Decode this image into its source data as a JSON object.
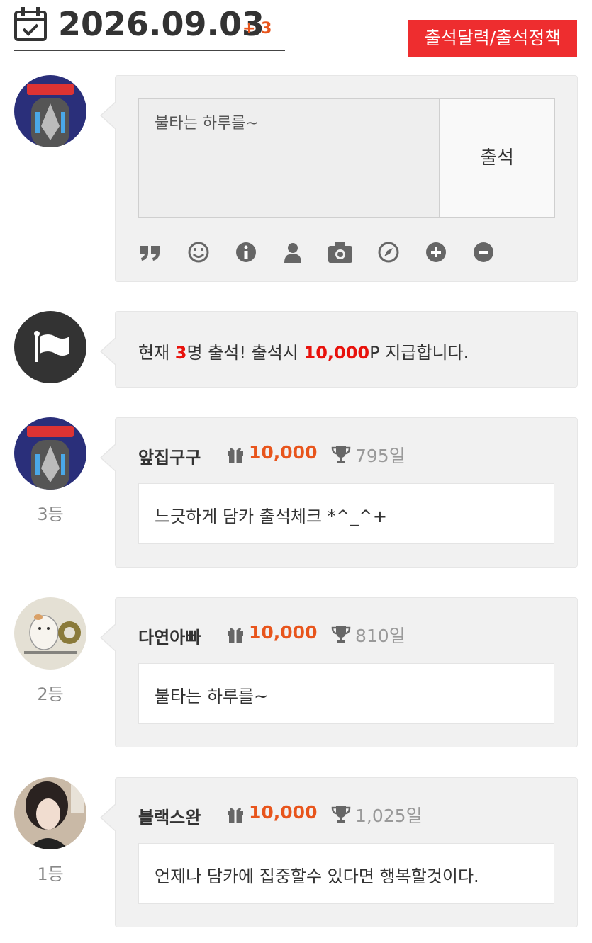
{
  "header": {
    "icon": "calendar-check-icon",
    "date": "2026.09.03",
    "plus": "+ 3",
    "policy_button": "출석달력/출석정책"
  },
  "compose": {
    "textarea_value": "불타는 하루를~",
    "submit_label": "출석",
    "toolbar_icons": [
      "quote-icon",
      "smiley-icon",
      "info-icon",
      "user-icon",
      "camera-icon",
      "compass-icon",
      "plus-circle-icon",
      "minus-circle-icon"
    ]
  },
  "notice": {
    "icon": "flag-icon",
    "prefix": "현재 ",
    "count": "3",
    "middle": "명 출석! 출석시 ",
    "points": "10,000",
    "suffix": "P 지급합니다."
  },
  "entries": [
    {
      "rank": "3등",
      "name": "앞집구구",
      "points": "10,000",
      "days": "795일",
      "message": "느긋하게 담카 출석체크 *^_^+"
    },
    {
      "rank": "2등",
      "name": "다연아빠",
      "points": "10,000",
      "days": "810일",
      "message": "불타는 하루를~"
    },
    {
      "rank": "1등",
      "name": "블랙스완",
      "points": "10,000",
      "days": "1,025일",
      "message": "언제나 담카에 집중할수 있다면 행복할것이다."
    }
  ],
  "colors": {
    "accent": "#e8551c",
    "highlight": "#e8120c",
    "policy_bg": "#ee2d2f",
    "card_bg": "#f1f1f1"
  }
}
